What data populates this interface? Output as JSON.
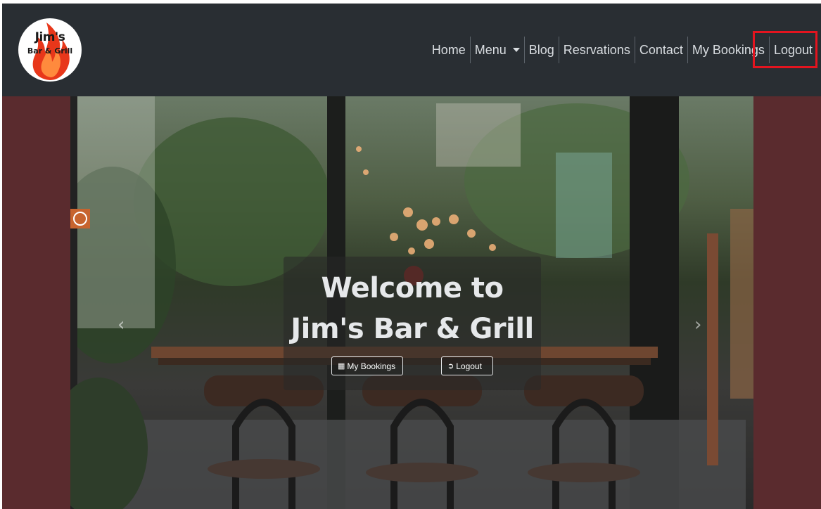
{
  "brand": {
    "logo_line1": "Jim's",
    "logo_line2": "Bar & Grill",
    "flame_color": "#e8371a"
  },
  "nav": {
    "items": [
      {
        "label": "Home"
      },
      {
        "label": "Menu"
      },
      {
        "label": "Blog"
      },
      {
        "label": "Resrvations"
      },
      {
        "label": "Contact"
      },
      {
        "label": "My Bookings"
      },
      {
        "label": "Logout"
      }
    ],
    "highlighted_item": "Logout",
    "highlight_color": "#e3141f"
  },
  "hero": {
    "title_line1": "Welcome to",
    "title_line2": "Jim's Bar & Grill",
    "buttons": [
      {
        "label": "My Bookings",
        "icon": "calendar-icon"
      },
      {
        "label": "Logout",
        "icon": "sign-out-icon"
      }
    ],
    "prev_icon": "chevron-left-icon",
    "next_icon": "chevron-right-icon",
    "background_color": "#5a2b2e"
  },
  "colors": {
    "navbar": "#292e33",
    "nav_text": "#d9dde1"
  }
}
